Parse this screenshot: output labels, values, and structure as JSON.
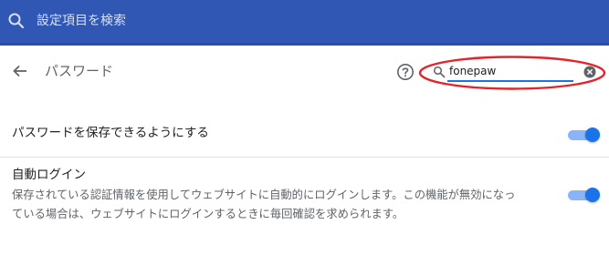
{
  "search_bar": {
    "placeholder": "設定項目を検索",
    "icon": "search-icon"
  },
  "header": {
    "title": "パスワード",
    "back_icon": "arrow-left-icon",
    "help_icon": "help-icon"
  },
  "password_search": {
    "value": "fonepaw",
    "icon": "search-icon",
    "clear_icon": "clear-icon"
  },
  "settings": [
    {
      "label": "パスワードを保存できるようにする",
      "enabled": true
    },
    {
      "label": "自動ログイン",
      "description_line1": "保存されている認証情報を使用してウェブサイトに自動的にログインします。この機能が無効になっ",
      "description_line2": "ている場合は、ウェブサイトにログインするときに毎回確認を求められます。",
      "enabled": true
    }
  ],
  "colors": {
    "topbar": "#2f57b3",
    "accent": "#1a73e8",
    "annotation": "#e0262b"
  }
}
